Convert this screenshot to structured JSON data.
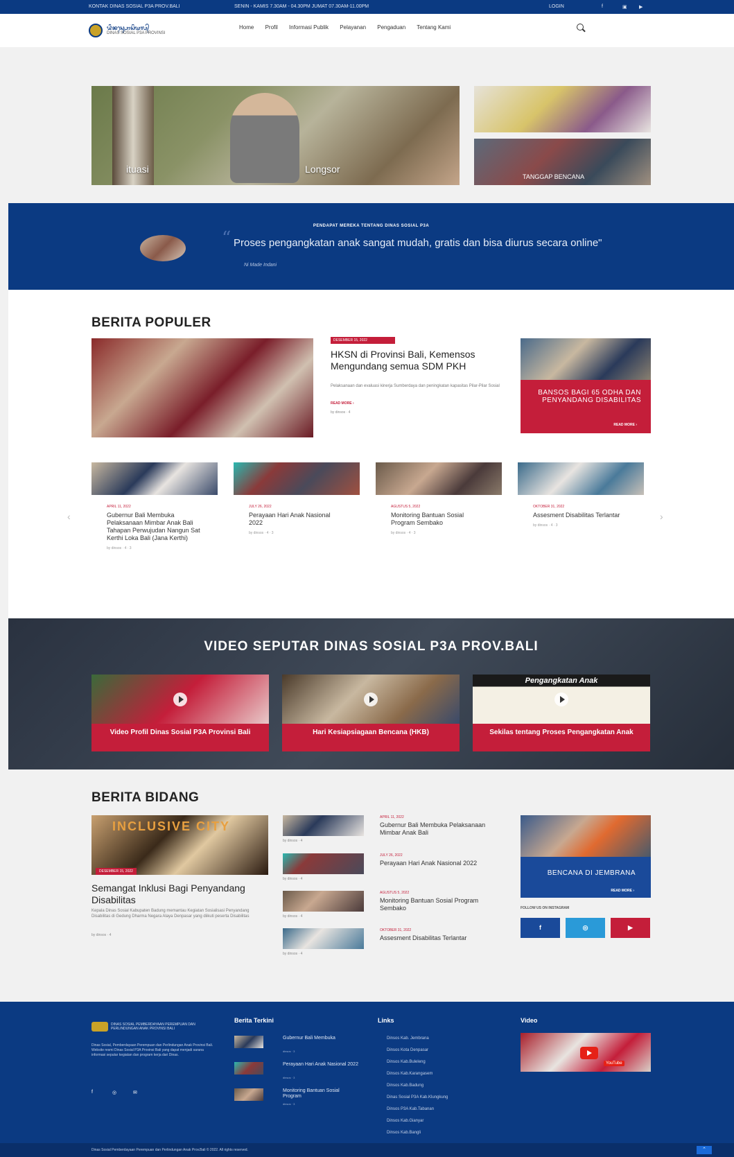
{
  "topbar": {
    "title": "KONTAK DINAS SOSIAL P3A PROV.BALI",
    "hours": "SENIN - KAMIS 7.30AM - 04.30PM JUMAT 07.30AM-11.00PM",
    "login": "LOGIN",
    "social": [
      "f",
      "▣",
      "▶"
    ]
  },
  "header": {
    "logo_title": "ᬤᬶᬦᬲ᭄ᬲᭀᬲᬶᬬᬮ᭄",
    "logo_subtitle": "DINAS SOSIAL P3A PROVINSI",
    "nav": [
      "Home",
      "Profil",
      "Informasi Publik",
      "Pelayanan",
      "Pengaduan",
      "Tentang Kami"
    ]
  },
  "hero": {
    "main_caption_left": "ituasi",
    "main_caption_right": "Longsor",
    "side2_caption": "TANGGAP BENCANA"
  },
  "quote": {
    "heading": "PENDAPAT MEREKA TENTANG DINAS SOSIAL P3A",
    "mark": "“",
    "text": "Proses pengangkatan anak sangat mudah, gratis dan bisa diurus secara online\"",
    "author": "Ni Made Indani"
  },
  "populer": {
    "title": "BERITA POPULER",
    "featured": {
      "date": "DESEMBER 15, 2022",
      "title": "HKSN di Provinsi Bali, Kemensos Mengundang semua SDM PKH",
      "excerpt": "Pelaksanaan dan evaluasi kinerja Sumberdaya dan peningkatan kapasitas Pilar-Pilar Sosial",
      "more": "READ MORE ›",
      "meta": "by dinsos · 4"
    },
    "side": {
      "title": "BANSOS BAGI 65 ODHA DAN PENYANDANG DISABILITAS",
      "more": "READ MORE ›"
    },
    "cards": [
      {
        "date": "APRIL 11, 2022",
        "title": "Gubernur Bali Membuka Pelaksanaan Mimbar Anak Bali Tahapan Perwujudan Nangun Sat Kerthi Loka Bali (Jana Kerthi)",
        "meta": "by dinsos · 4 · 3"
      },
      {
        "date": "JULY 26, 2022",
        "title": "Perayaan Hari Anak Nasional 2022",
        "meta": "by dinsos · 4 · 3"
      },
      {
        "date": "AGUSTUS 5, 2022",
        "title": "Monitoring Bantuan Sosial Program Sembako",
        "meta": "by dinsos · 4 · 3"
      },
      {
        "date": "OKTOBER 31, 2022",
        "title": "Assesment Disabilitas Terlantar",
        "meta": "by dinsos · 4 · 3"
      }
    ],
    "prev": "‹",
    "next": "›"
  },
  "video": {
    "title": "VIDEO SEPUTAR DINAS SOSIAL P3A PROV.BALI",
    "items": [
      {
        "caption": "Video Profil Dinas Sosial P3A Provinsi Bali"
      },
      {
        "caption": "Hari Kesiapsiagaan Bencana (HKB)"
      },
      {
        "caption": "Sekilas tentang Proses Pengangkatan Anak",
        "thumb_text": "Pengangkatan Anak"
      }
    ]
  },
  "bidang": {
    "title": "BERITA BIDANG",
    "featured": {
      "img_text": "INCLUSIVE CITY",
      "date": "DESEMBER 15, 2022",
      "title": "Semangat Inklusi Bagi Penyandang Disabilitas",
      "excerpt": "Kepala Dinas Sosial Kabupaten Badung memantau Kegiatan Sosialisasi Penyandang Disabilitas di Gedung Dharma Negara Alaya Denpasar yang diikuti peserta Disabilitas",
      "meta": "by dinsos · 4"
    },
    "list": [
      {
        "date": "APRIL 11, 2022",
        "title": "Gubernur Bali Membuka Pelaksanaan Mimbar Anak Bali",
        "meta": "by dinsos · 4"
      },
      {
        "date": "JULY 26, 2022",
        "title": "Perayaan Hari Anak Nasional 2022",
        "meta": "by dinsos · 4"
      },
      {
        "date": "AGUSTUS 5, 2022",
        "title": "Monitoring Bantuan Sosial Program Sembako",
        "meta": "by dinsos · 4"
      },
      {
        "date": "OKTOBER 31, 2022",
        "title": "Assesment Disabilitas Terlantar",
        "meta": "by dinsos · 4"
      }
    ],
    "side": {
      "title": "BENCANA DI JEMBRANA",
      "more": "READ MORE ›"
    },
    "follow": "FOLLOW US ON INSTAGRAM",
    "social": [
      "f",
      "◎",
      "▶"
    ]
  },
  "footer": {
    "logo_text": "DINAS SOSIAL PEMBERDAYAAN PEREMPUAN DAN PERLINDUNGAN ANAK PROVINSI BALI",
    "about": "Dinas Sosial, Pemberdayaan Perempuan dan Perlindungan Anak Provinsi Bali. Website resmi Dinas Sosial P3A Provinsi Bali yang dapat menjadi sarana informasi seputar kegiatan dan program kerja dari Dinas.",
    "social": [
      "f",
      "◎",
      "✉"
    ],
    "col_news": "Berita Terkini",
    "news": [
      {
        "title": "Gubernur Bali Membuka",
        "meta": "dinsos · 3"
      },
      {
        "title": "Perayaan Hari Anak Nasional 2022",
        "meta": "dinsos · 3"
      },
      {
        "title": "Monitoring Bantuan Sosial Program",
        "meta": "dinsos · 3"
      }
    ],
    "col_links": "Links",
    "links": [
      "Dinsos Kab. Jembrana",
      "Dinsos Kota Denpasar",
      "Dinsos Kab.Buleleng",
      "Dinsos Kab.Karangasem",
      "Dinsos Kab.Badung",
      "Dinas Sosial P3A Kab.Klungkung",
      "Dinsos P3A Kab.Tabanan",
      "Dinsos Kab.Gianyar",
      "Dinsos Kab.Bangli"
    ],
    "col_video": "Video",
    "video_label": "YouTube"
  },
  "copyright": "Dinas Sosial Pemberdayaan Perempuan dan Perlindungan Anak Prov.Bali © 2022. All rights reserved.",
  "totop": "⌃"
}
